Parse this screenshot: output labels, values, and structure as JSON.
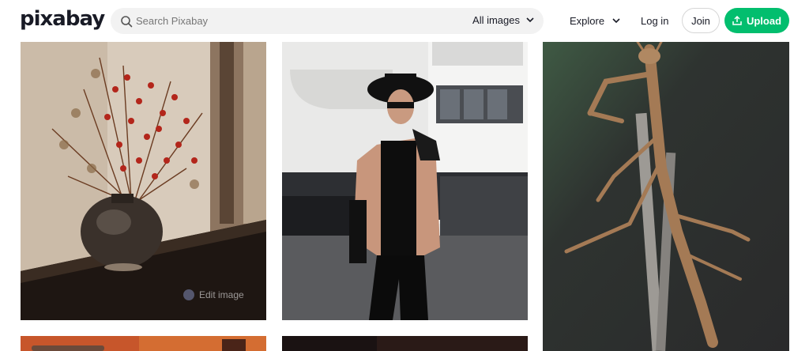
{
  "header": {
    "logo": "pixabay",
    "search": {
      "placeholder": "Search Pixabay",
      "filter": "All images"
    },
    "nav": {
      "explore": "Explore",
      "login": "Log in",
      "join": "Join",
      "upload": "Upload"
    }
  },
  "gallery": {
    "edit_image_label": "Edit image"
  },
  "colors": {
    "brand_green": "#02be6e",
    "text": "#191b26"
  }
}
